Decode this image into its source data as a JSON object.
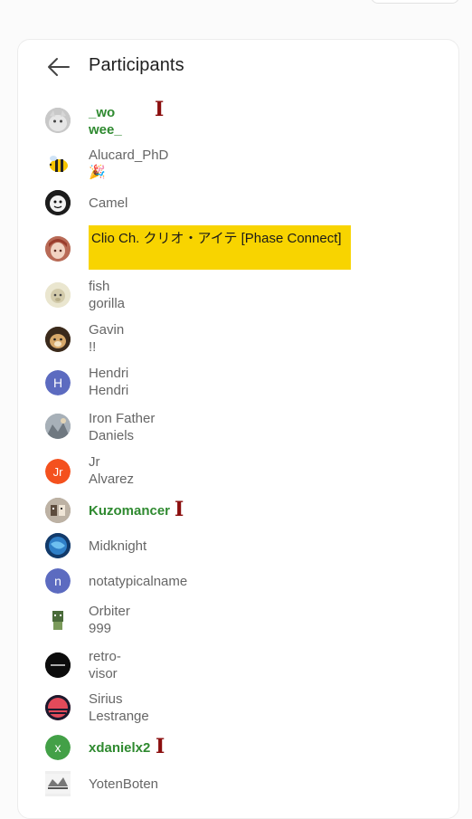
{
  "header": {
    "title": "Participants",
    "back_icon": "arrow-left-icon"
  },
  "participants": [
    {
      "name_line1": "_wo",
      "name_line2": "wee_",
      "avatar": "cat-photo",
      "highlight": "moderator-green",
      "cursor": true
    },
    {
      "name_line1": "Alucard_PhD",
      "name_line2": "🎉",
      "avatar": "bee"
    },
    {
      "name_line1": "Camel",
      "avatar": "cartoon-face"
    },
    {
      "name_line1": "Clio Ch. クリオ・アイテ [Phase Connect]",
      "avatar": "anime-girl",
      "highlight": "owner-yellow"
    },
    {
      "name_line1": "fish",
      "name_line2": "gorilla",
      "avatar": "gorilla"
    },
    {
      "name_line1": "Gavin",
      "name_line2": "!!",
      "avatar": "dog"
    },
    {
      "name_line1": "Hendri",
      "name_line2": "Hendri",
      "avatar_letter": "H",
      "avatar_color": "#5c6bc0"
    },
    {
      "name_line1": "Iron Father",
      "name_line2": "Daniels",
      "avatar": "photo"
    },
    {
      "name_line1": "Jr",
      "name_line2": "Alvarez",
      "avatar_letter": "Jr",
      "avatar_color": "#f4511e"
    },
    {
      "name_line1": "Kuzomancer",
      "avatar": "pixel-art",
      "highlight": "moderator-green",
      "cursor": true
    },
    {
      "name_line1": "Midknight",
      "avatar": "blue-planet"
    },
    {
      "name_line1": "notatypicalname",
      "avatar_letter": "n",
      "avatar_color": "#5c6bc0"
    },
    {
      "name_line1": "Orbiter",
      "name_line2": "999",
      "avatar": "green-character"
    },
    {
      "name_line1": "retro-",
      "name_line2": "visor",
      "avatar": "black-logo"
    },
    {
      "name_line1": "Sirius",
      "name_line2": "Lestrange",
      "avatar": "red-sunset"
    },
    {
      "name_line1": "xdanielx2",
      "avatar_letter": "x",
      "avatar_color": "#43a047",
      "highlight": "moderator-green",
      "cursor": true
    },
    {
      "name_line1": "YotenBoten",
      "avatar": "sketch"
    }
  ]
}
